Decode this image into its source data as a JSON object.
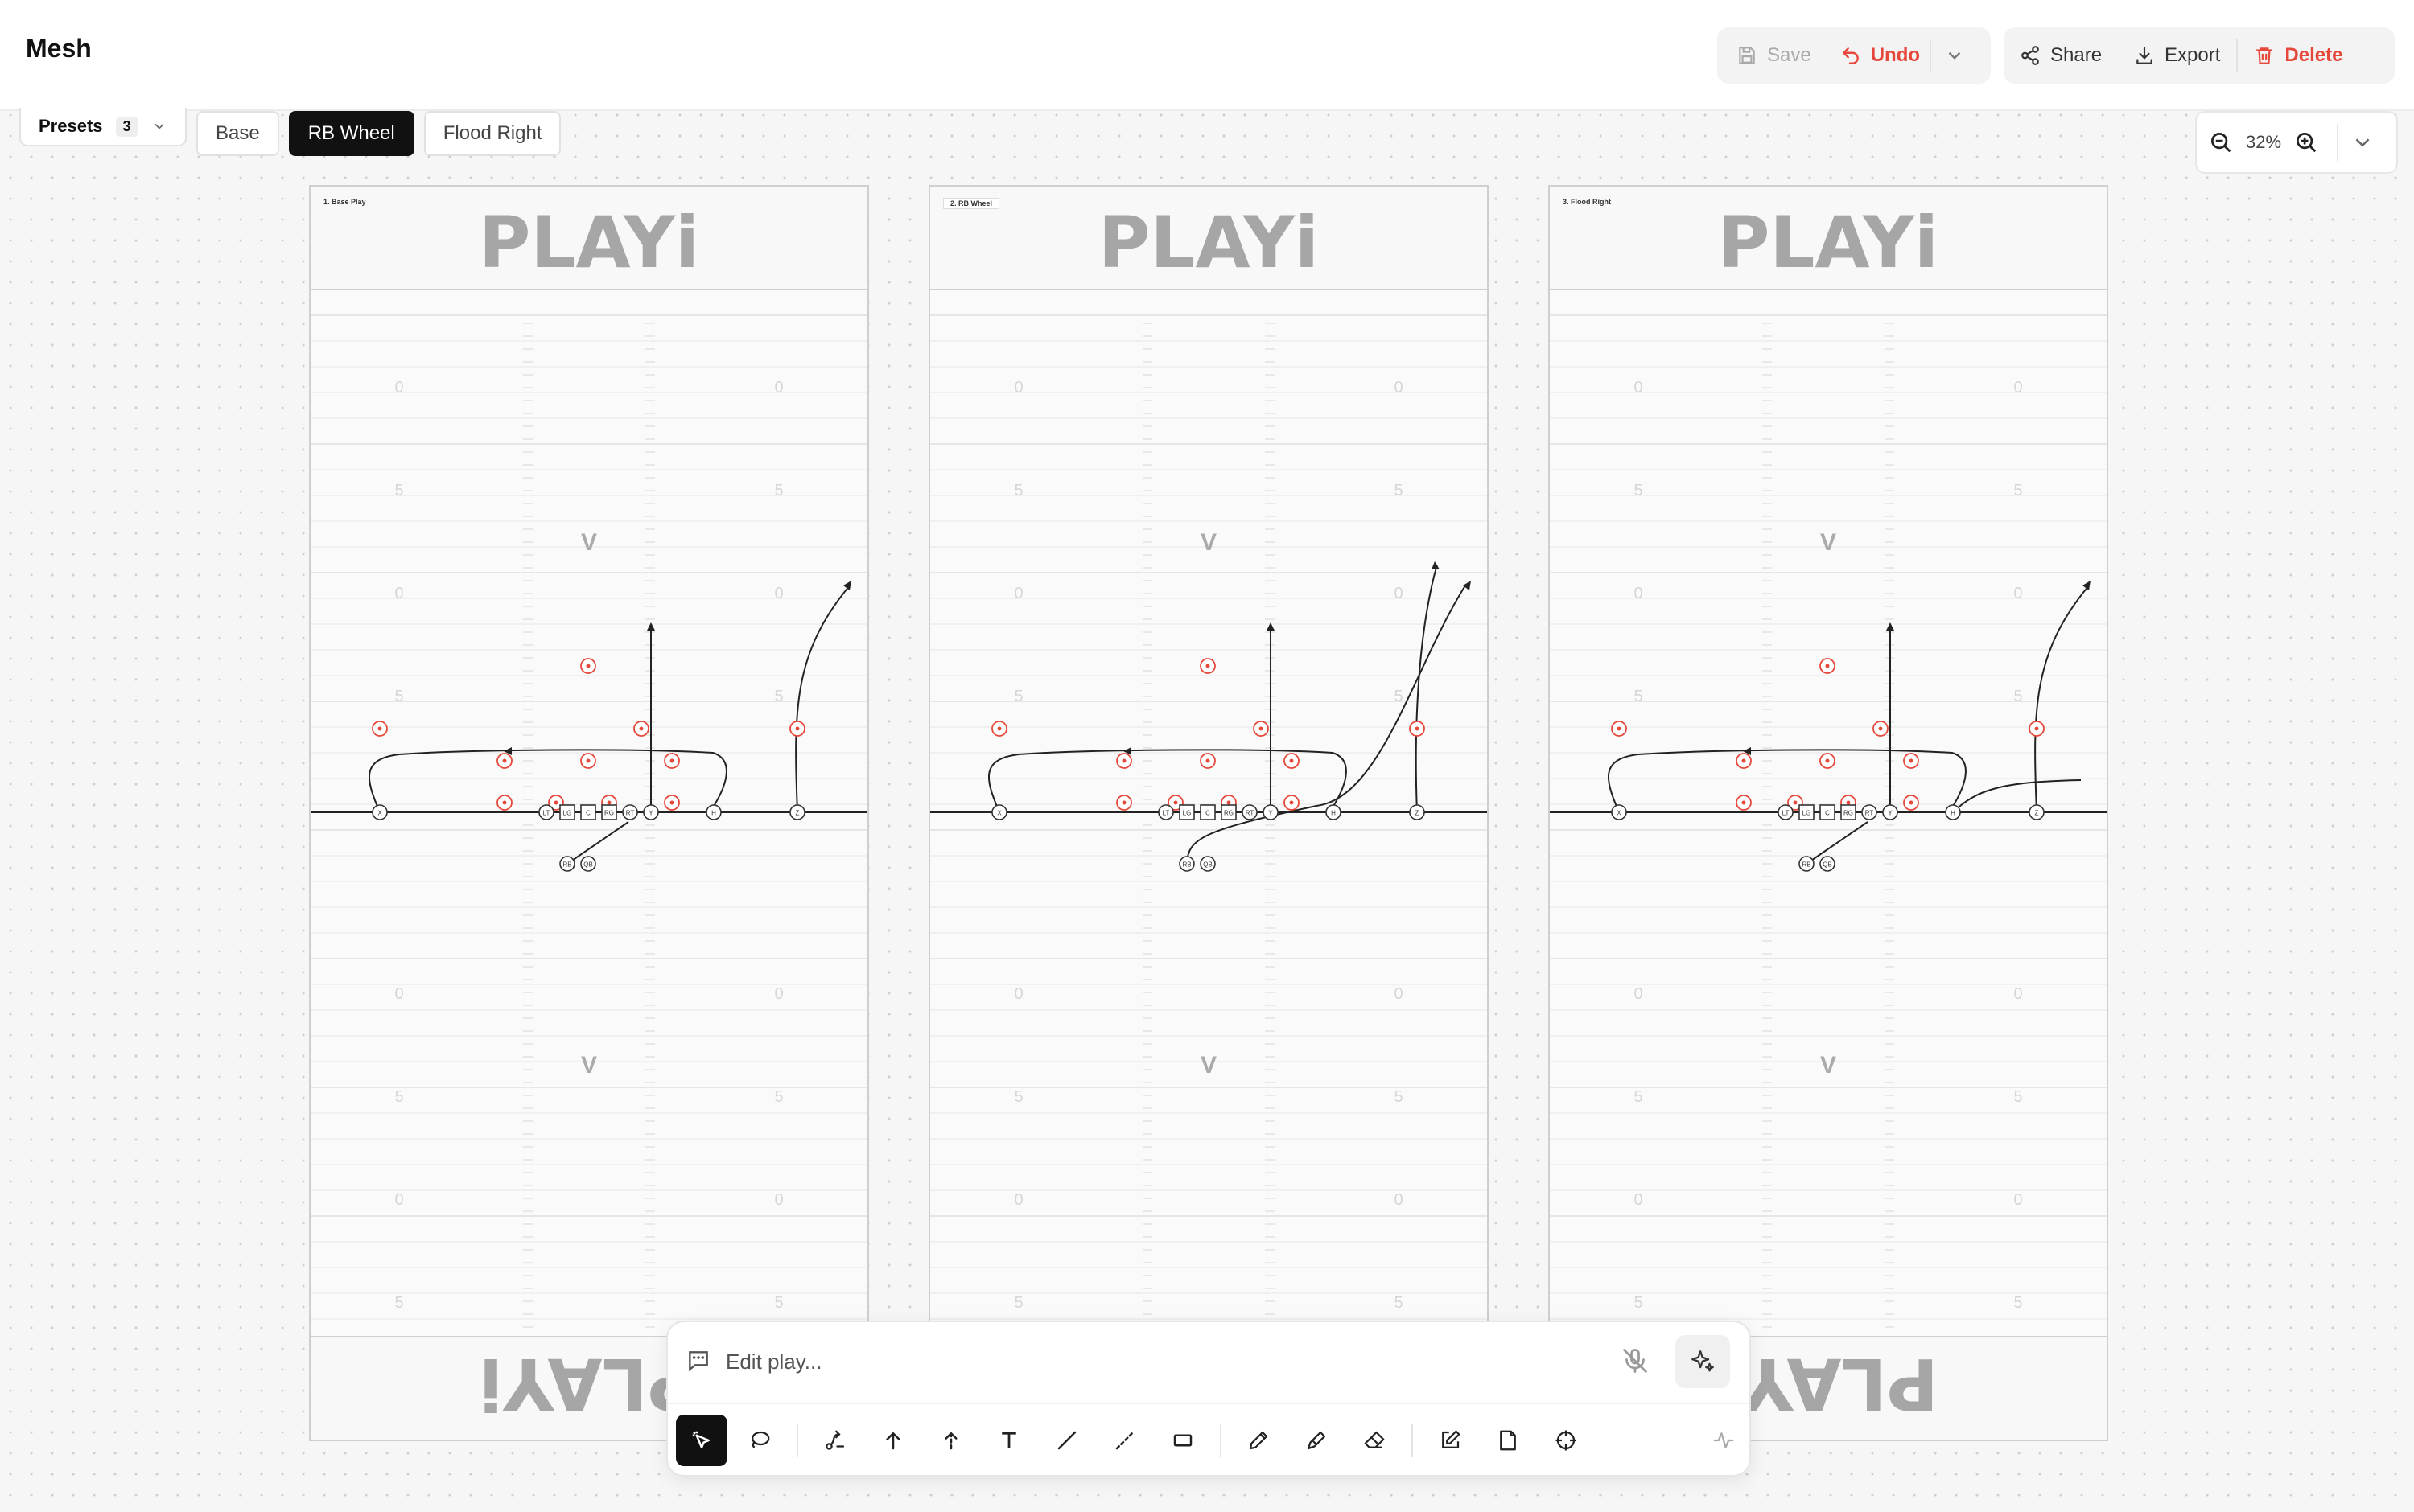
{
  "app": {
    "title": "Mesh"
  },
  "toolbar": {
    "save": "Save",
    "undo": "Undo",
    "share": "Share",
    "export": "Export",
    "delete": "Delete"
  },
  "presets": {
    "label": "Presets",
    "count": "3"
  },
  "tabs": [
    {
      "label": "Base"
    },
    {
      "label": "RB Wheel",
      "active": true
    },
    {
      "label": "Flood Right"
    }
  ],
  "zoom": {
    "value": "32%"
  },
  "sheets": [
    {
      "label": "1. Base Play",
      "logo": "PLAYi"
    },
    {
      "label": "2. RB Wheel",
      "logo": "PLAYi"
    },
    {
      "label": "3. Flood Right",
      "logo": "PLAYi"
    }
  ],
  "chat": {
    "placeholder": "Edit play..."
  },
  "tools": [
    "select-tool",
    "lasso-tool",
    "route-tool",
    "arrow-tool",
    "dashed-arrow-tool",
    "text-tool",
    "line-tool",
    "dashed-line-tool",
    "rectangle-tool",
    "pencil-tool",
    "highlighter-tool",
    "eraser-tool",
    "edit-tool",
    "note-tool",
    "target-tool"
  ],
  "colors": {
    "accent": "#e5483a",
    "active": "#111111"
  }
}
